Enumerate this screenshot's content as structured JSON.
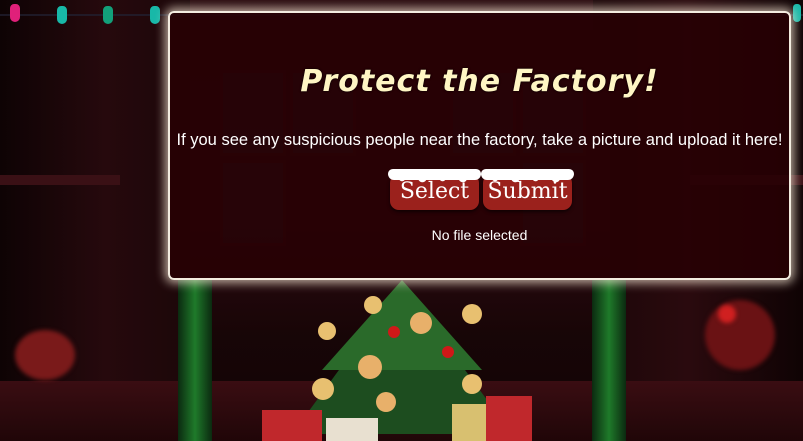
{
  "modal": {
    "title": "Protect the Factory!",
    "instructions": "If you see any suspicious people near the factory, take a picture and upload it here!",
    "select_label": "Select",
    "submit_label": "Submit",
    "file_status": "No file selected"
  },
  "colors": {
    "modal_background": "#280004",
    "modal_border": "#f3ece0",
    "title": "#fff6c4",
    "button": "#9b211c",
    "button_text": "#ffffff"
  },
  "background": {
    "description_icons": [
      "christmas-tree-icon",
      "string-lights-icon",
      "gift-icon"
    ]
  }
}
